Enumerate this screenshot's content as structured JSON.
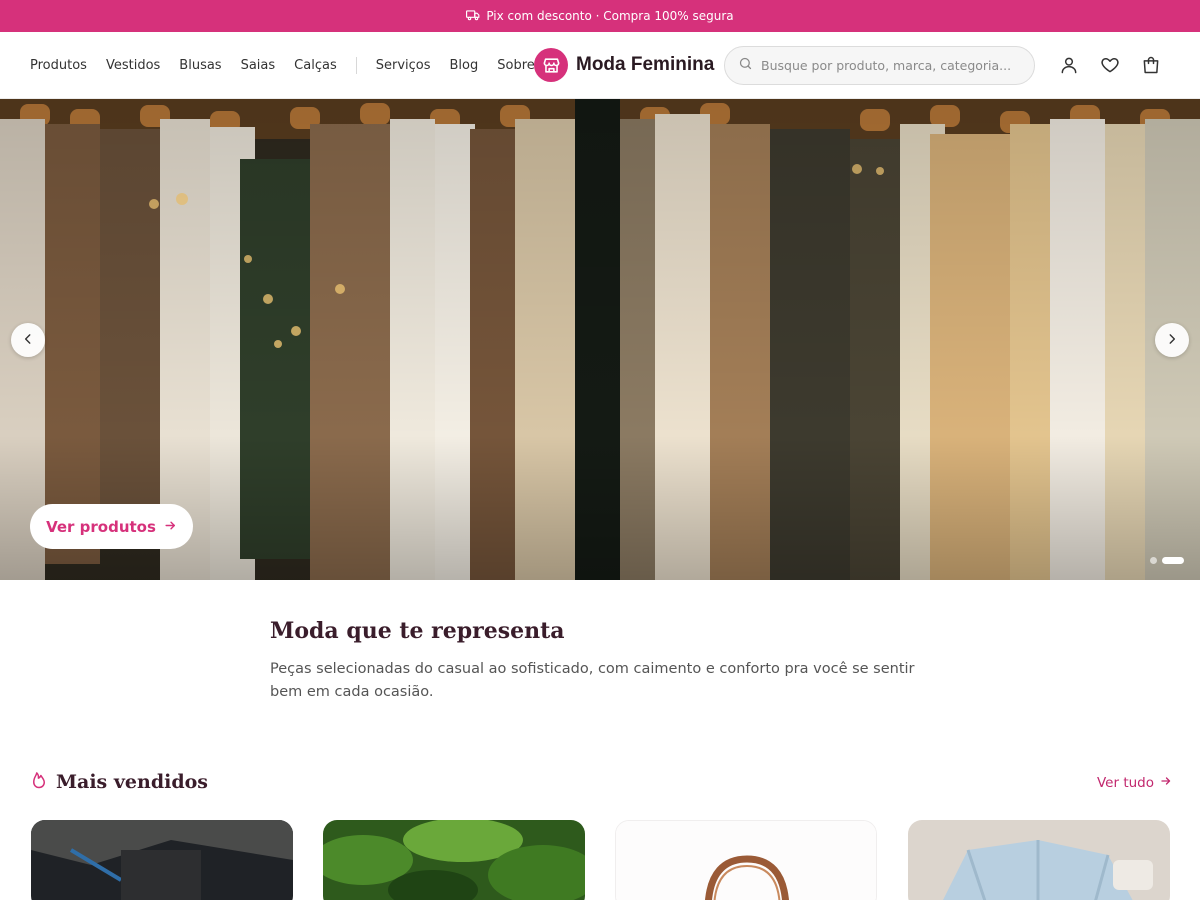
{
  "announcement": {
    "icon": "truck-icon",
    "text": "Pix com desconto · Compra 100% segura"
  },
  "header": {
    "nav": [
      {
        "label": "Produtos"
      },
      {
        "label": "Vestidos"
      },
      {
        "label": "Blusas"
      },
      {
        "label": "Saias"
      },
      {
        "label": "Calças"
      },
      {
        "label": "Serviços"
      },
      {
        "label": "Blog"
      },
      {
        "label": "Sobre"
      }
    ],
    "logo": {
      "icon": "store-icon",
      "text": "Moda Feminina"
    },
    "search": {
      "placeholder": "Busque por produto, marca, categoria..."
    },
    "icons": [
      "user-icon",
      "heart-icon",
      "shopping-bag-icon"
    ]
  },
  "hero": {
    "cta_label": "Ver produtos",
    "slides_count": 2,
    "active_slide": 2
  },
  "intro": {
    "title": "Moda que te representa",
    "text": "Peças selecionadas do casual ao sofisticado, com caimento e conforto pra você se sentir bem em cada ocasião."
  },
  "best_sellers": {
    "icon": "flame-icon",
    "title": "Mais vendidos",
    "see_all": "Ver tudo"
  },
  "colors": {
    "brand": "#d6317b",
    "heading": "#3a1d2b"
  }
}
